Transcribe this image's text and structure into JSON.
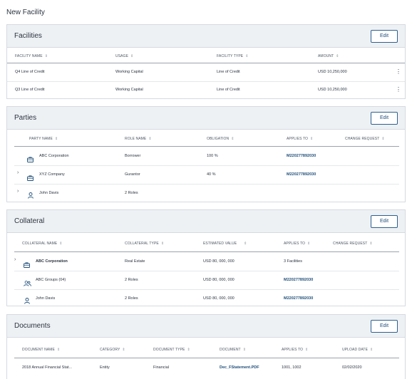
{
  "page": {
    "title": "New Facility"
  },
  "colors": {
    "accent": "#1f4e7a",
    "header_bg": "#eef1f4",
    "border": "#d5dae0"
  },
  "icons": {
    "sort": "sort-icon",
    "kebab": "kebab-menu-icon",
    "chevron": "chevron-right-icon",
    "briefcase": "briefcase-icon",
    "group": "group-icon",
    "person": "person-icon"
  },
  "facilities": {
    "title": "Facilities",
    "edit_label": "Edit",
    "columns": [
      "FACILITY NAME",
      "USAGE",
      "FACILITY TYPE",
      "AMOUNT"
    ],
    "rows": [
      {
        "name": "Q4 Line of Credit",
        "usage": "Working Capital",
        "type": "Line of Credit",
        "amount": "USD  10,250,000"
      },
      {
        "name": "Q3 Line of Credit",
        "usage": "Working Capital",
        "type": "Line of Credit",
        "amount": "USD  10,250,000"
      }
    ]
  },
  "parties": {
    "title": "Parties",
    "edit_label": "Edit",
    "columns": [
      "PARTY NAME",
      "ROLE NAME",
      "OBLIGATION",
      "APPLIES TO",
      "CHANGE REQUEST"
    ],
    "rows": [
      {
        "name": "ABC Corporation",
        "role": "Borrower",
        "obligation": "100 %",
        "applies": "M220277892030"
      },
      {
        "name": "XYZ Company",
        "role": "Gurantor",
        "obligation": "40 %",
        "applies": "M220277892030"
      },
      {
        "name": "John Davis",
        "role": "2 Roles",
        "obligation": "",
        "applies": ""
      }
    ]
  },
  "collateral": {
    "title": "Collateral",
    "edit_label": "Edit",
    "columns": [
      "COLLATERAL NAME",
      "COLLATERAL TYPE",
      "ESTIMATED VALUE",
      "APPLIES TO",
      "CHANGE REQUEST"
    ],
    "rows": [
      {
        "name": "ABC Corporation",
        "type": "Real Estate",
        "value": "USD 80, 000, 000",
        "applies": "3 Facilities"
      },
      {
        "name": "ABC Groups (04)",
        "type": "2 Roles",
        "value": "USD 80, 000, 000",
        "applies": "M220277892030"
      },
      {
        "name": "John Davis",
        "type": "2 Roles",
        "value": "USD 80, 000, 000",
        "applies": "M220277892030"
      }
    ]
  },
  "documents": {
    "title": "Documents",
    "edit_label": "Edit",
    "columns": [
      "DOCUMENT NAME",
      "CATEGORY",
      "DOCUMENT TYPE",
      "DOCUMENT",
      "APPLIES TO",
      "UPLOAD DATE"
    ],
    "rows": [
      {
        "name": "2018 Annual Financial Stat...",
        "category": "Entity",
        "type": "Financial",
        "document": "Dec_FStatement.PDF",
        "applies": "1001, 1002",
        "date": "02/02/2020"
      }
    ]
  }
}
